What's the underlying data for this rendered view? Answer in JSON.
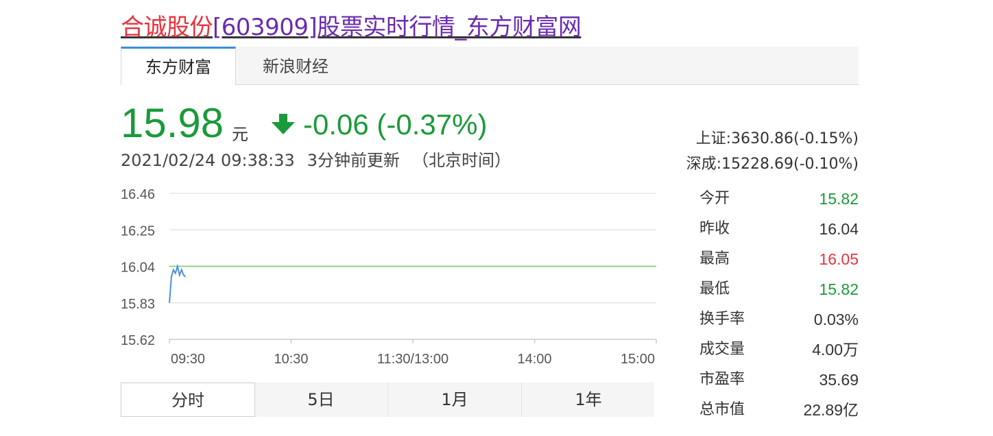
{
  "title": {
    "name": "合诚股份",
    "rest": "[603909]股票实时行情_东方财富网"
  },
  "tabs": [
    {
      "label": "东方财富"
    },
    {
      "label": "新浪财经"
    }
  ],
  "quote": {
    "price": "15.98",
    "unit": "元",
    "change": "-0.06 (-0.37%)",
    "direction_color": "#1a9a3a",
    "date": "2021/02/24 09:38:33",
    "updated": "3分钟前更新",
    "timezone": "（北京时间）"
  },
  "indices": [
    {
      "text": "上证:3630.86(-0.15%)"
    },
    {
      "text": "深成:15228.69(-0.10%)"
    }
  ],
  "stats": [
    {
      "label": "今开",
      "value": "15.82",
      "color": "green"
    },
    {
      "label": "昨收",
      "value": "16.04",
      "color": "neutral"
    },
    {
      "label": "最高",
      "value": "16.05",
      "color": "red"
    },
    {
      "label": "最低",
      "value": "15.82",
      "color": "green"
    },
    {
      "label": "换手率",
      "value": "0.03%",
      "color": "neutral"
    },
    {
      "label": "成交量",
      "value": "4.00万",
      "color": "neutral"
    },
    {
      "label": "市盈率",
      "value": "35.69",
      "color": "neutral"
    },
    {
      "label": "总市值",
      "value": "22.89亿",
      "color": "neutral"
    }
  ],
  "chart_data": {
    "type": "line",
    "y_ticks": [
      "16.46",
      "16.25",
      "16.04",
      "15.83",
      "15.62"
    ],
    "ylim": [
      15.62,
      16.46
    ],
    "x_ticks": [
      "09:30",
      "10:30",
      "11:30/13:00",
      "14:00",
      "15:00"
    ],
    "reference_line": 16.04,
    "series": [
      {
        "color": "#4a8fe0",
        "x_minutes": [
          0,
          1,
          2,
          3,
          4,
          5,
          6,
          7,
          8
        ],
        "values": [
          15.83,
          15.98,
          16.02,
          16.0,
          16.04,
          15.99,
          16.02,
          15.99,
          15.98
        ]
      }
    ]
  },
  "period_tabs": [
    {
      "label": "分时"
    },
    {
      "label": "5日"
    },
    {
      "label": "1月"
    },
    {
      "label": "1年"
    }
  ]
}
